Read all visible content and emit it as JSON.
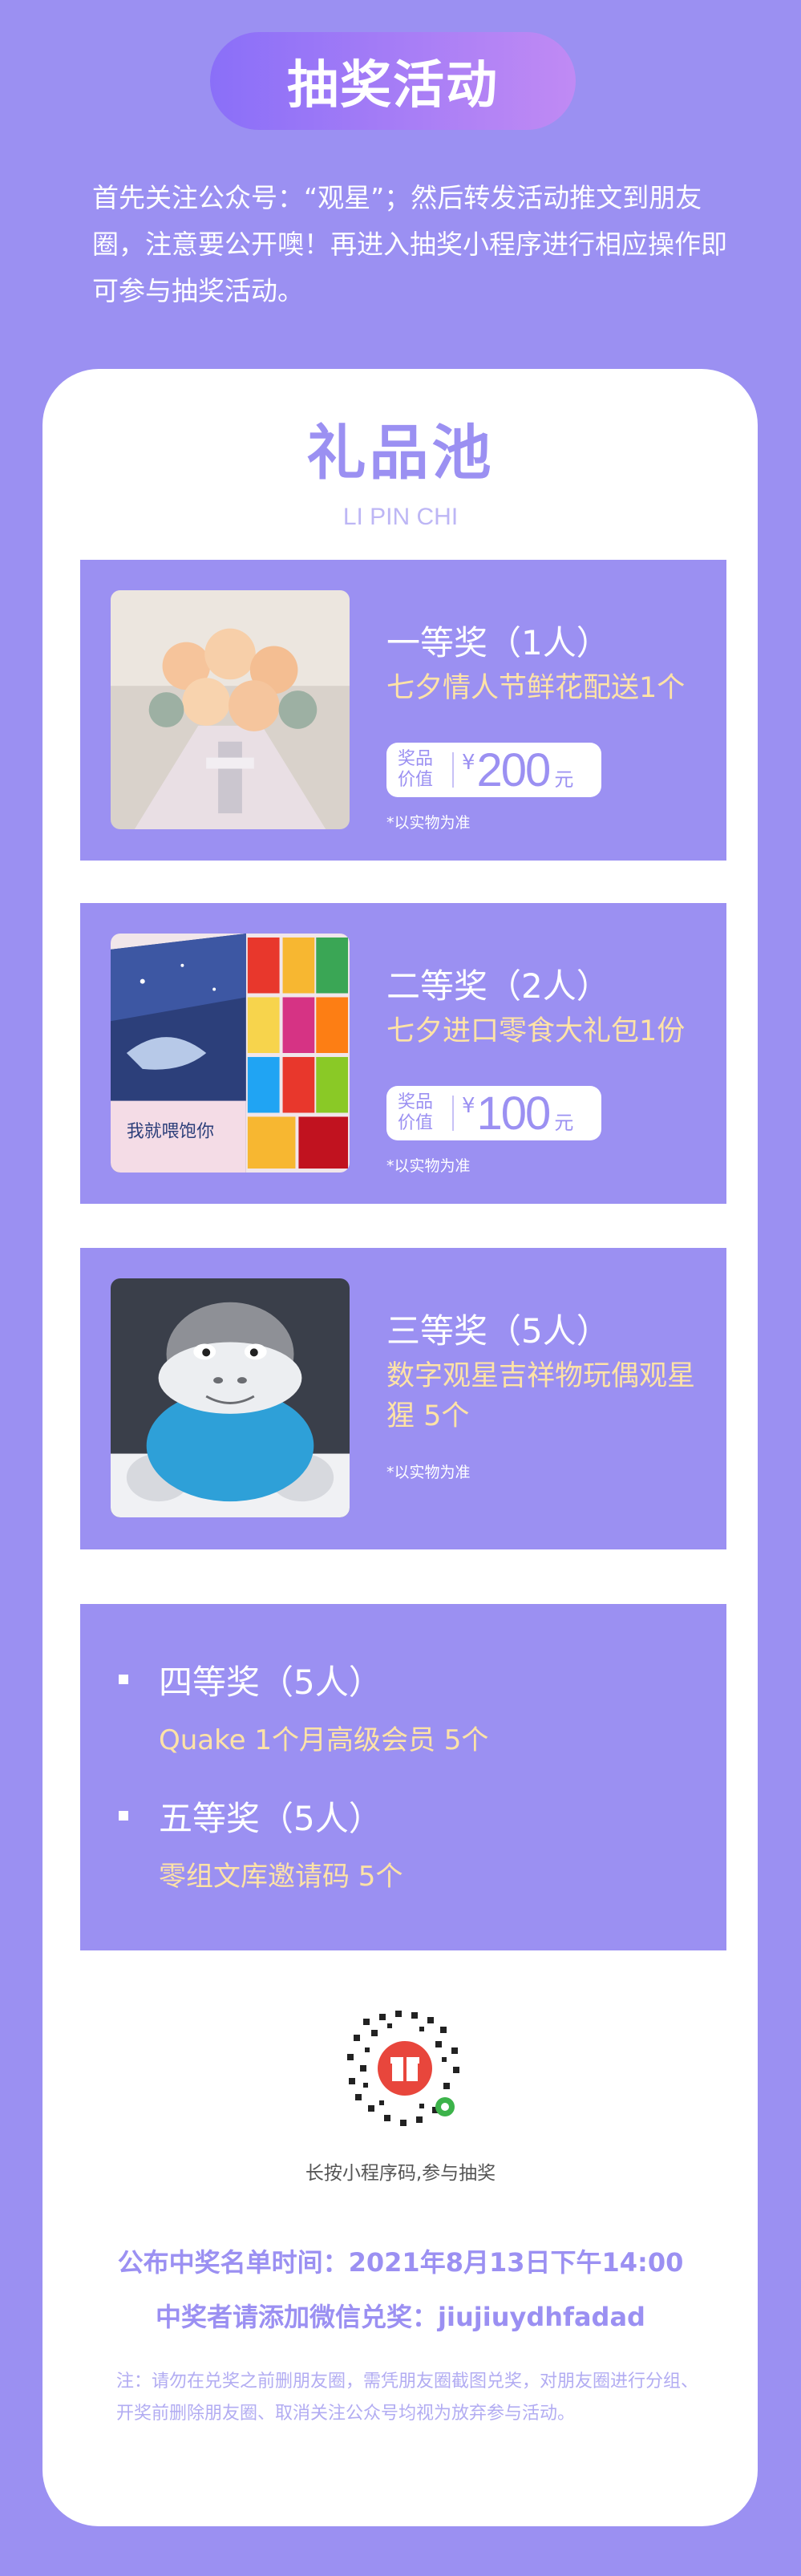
{
  "header": {
    "title": "抽奖活动",
    "intro": "首先关注公众号：“观星”；然后转发活动推文到朋友圈，注意要公开噢！再进入抽奖小程序进行相应操作即可参与抽奖活动。"
  },
  "pool": {
    "title": "礼品池",
    "subtitle": "LI PIN CHI"
  },
  "prizes": [
    {
      "title": "一等奖（1人）",
      "desc": "七夕情人节鲜花配送1个",
      "value_label": "奖品价值",
      "currency": "¥",
      "value": "200",
      "unit": "元",
      "note": "*以实物为准",
      "image_icon": "flower-bouquet-image"
    },
    {
      "title": "二等奖（2人）",
      "desc": "七夕进口零食大礼包1份",
      "value_label": "奖品价值",
      "currency": "¥",
      "value": "100",
      "unit": "元",
      "note": "*以实物为准",
      "image_icon": "snack-gift-box-image",
      "box_text": "我就喂饱你"
    },
    {
      "title": "三等奖（5人）",
      "desc": "数字观星吉祥物玩偶观星猩 5个",
      "note": "*以实物为准",
      "image_icon": "gorilla-plush-image"
    }
  ],
  "minor_prizes": [
    {
      "title": "四等奖（5人）",
      "desc": "Quake 1个月高级会员  5个"
    },
    {
      "title": "五等奖（5人）",
      "desc": "零组文库邀请码  5个"
    }
  ],
  "qr": {
    "icon": "mini-program-qr-icon",
    "caption": "长按小程序码,参与抽奖"
  },
  "info": {
    "announce": "公布中奖名单时间：2021年8月13日下午14:00",
    "contact": "中奖者请添加微信兑奖：jiujiuydhfadad"
  },
  "footnote": "注：请勿在兑奖之前删朋友圈，需凭朋友圈截图兑奖，对朋友圈进行分组、开奖前删除朋友圈、取消关注公众号均视为放弃参与活动。",
  "colors": {
    "background": "#9b90f2",
    "accent_text": "#ffe3a6",
    "banner_start": "#8a6ff8",
    "banner_end": "#c08af4"
  }
}
